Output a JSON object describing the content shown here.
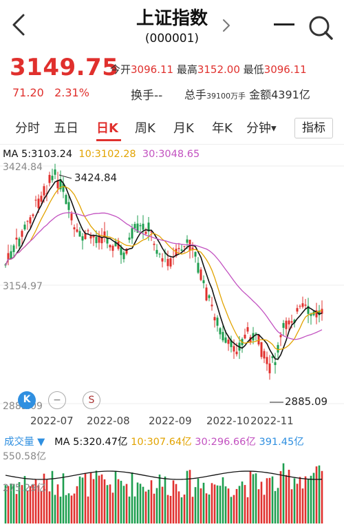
{
  "header": {
    "title": "上证指数",
    "code": "(000001)"
  },
  "quote": {
    "price": "3149.75",
    "open_label": "今开",
    "open": "3096.11",
    "high_label": "最高",
    "high": "3152.00",
    "low_label": "最低",
    "low": "3096.11",
    "change": "71.20",
    "change_pct": "2.31%",
    "turnover_label": "换手--",
    "total_hands_label": "总手",
    "total_hands": "39100万手",
    "amount_label": "金额",
    "amount": "4391亿"
  },
  "tabs": [
    {
      "label": "分时",
      "active": false
    },
    {
      "label": "五日",
      "active": false
    },
    {
      "label": "日K",
      "active": true
    },
    {
      "label": "周K",
      "active": false
    },
    {
      "label": "月K",
      "active": false
    },
    {
      "label": "年K",
      "active": false
    },
    {
      "label": "分钟",
      "active": false
    }
  ],
  "indicator_button": "指标",
  "ma": {
    "label": "MA",
    "ma5": "5:3103.24",
    "ma10": "10:3102.28",
    "ma30": "30:3048.65"
  },
  "price_axis": {
    "top": "3424.84",
    "mid": "3154.97",
    "bottom": "2885.09",
    "max_marker": "3424.84",
    "min_marker": "2885.09"
  },
  "dates": [
    "2022-07",
    "2022-08",
    "2022-09",
    "2022-10",
    "2022-11"
  ],
  "controls": {
    "k_label": "K",
    "minus_label": "−",
    "s_label": "S"
  },
  "volume": {
    "label": "成交量",
    "ma_label": "MA",
    "ma5": "5:320.47亿",
    "ma10": "10:307.64亿",
    "ma30": "30:296.66亿",
    "extra": "391.45亿",
    "axis_top": "550.58亿",
    "axis_mid": "275.29亿"
  },
  "colors": {
    "up": "#e0302d",
    "down": "#1e9e4f",
    "ma5": "#111111",
    "ma10": "#e2a300",
    "ma30": "#c251c0"
  },
  "chart_data": {
    "type": "candlestick",
    "ylim": [
      2885.09,
      3424.84
    ],
    "max_value": 3424.84,
    "min_value": 2885.09,
    "last_close": 3149.75,
    "x_ticks": [
      "2022-07",
      "2022-08",
      "2022-09",
      "2022-10",
      "2022-11"
    ]
  }
}
